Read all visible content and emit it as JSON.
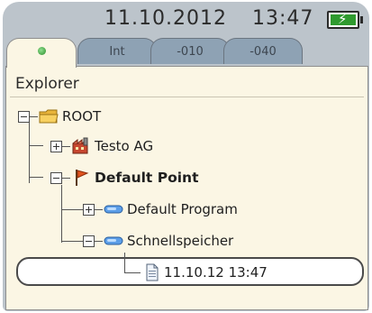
{
  "status": {
    "date": "11.10.2012",
    "time": "13:47",
    "battery_icon": "battery-charging-icon"
  },
  "tabs": [
    {
      "label": "",
      "icon": "star-icon",
      "active": true
    },
    {
      "label": "Int",
      "active": false
    },
    {
      "label": "-010",
      "active": false
    },
    {
      "label": "-040",
      "active": false
    }
  ],
  "explorer": {
    "title": "Explorer",
    "tree": {
      "root": {
        "label": "ROOT",
        "icon": "folder-icon"
      },
      "company": {
        "label": "Testo AG",
        "icon": "factory-icon"
      },
      "location": {
        "label": "Default Point",
        "icon": "flag-icon"
      },
      "program": {
        "label": "Default Program",
        "icon": "probe-icon"
      },
      "quick_store": {
        "label": "Schnellspeicher",
        "icon": "probe-icon"
      },
      "record": {
        "label": "11.10.12 13:47",
        "icon": "document-icon"
      }
    }
  },
  "colors": {
    "frame": "#bcc4cb",
    "panel": "#fbf6e4",
    "tab_inactive": "#8ea2b4",
    "battery": "#2f9a2f"
  }
}
